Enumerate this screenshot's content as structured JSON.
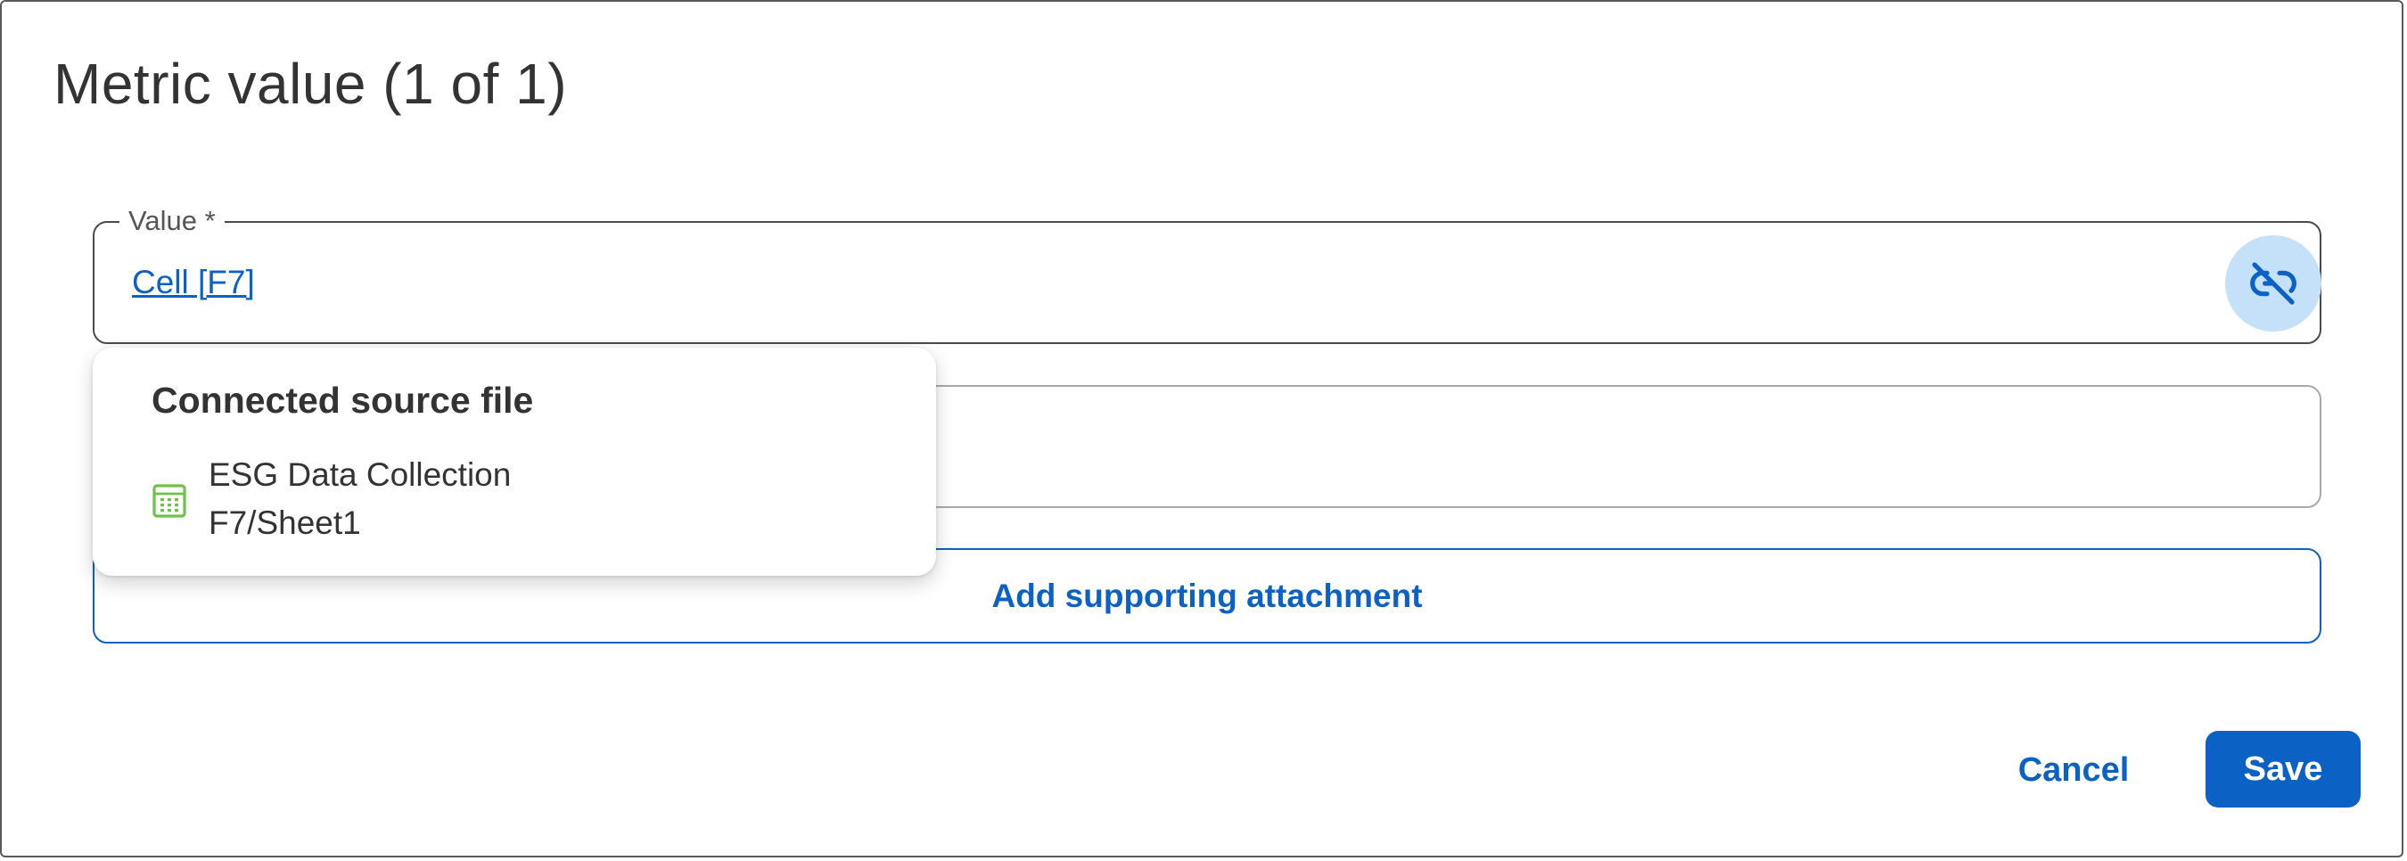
{
  "dialog": {
    "title": "Metric value (1 of 1)"
  },
  "value_field": {
    "label": "Value *",
    "value": "Cell [F7]",
    "unlink_icon": "link-off-icon"
  },
  "popover": {
    "title": "Connected source file",
    "file_icon": "spreadsheet-icon",
    "file_name": "ESG Data Collection",
    "file_path": "F7/Sheet1"
  },
  "attachment_button": {
    "label": "Add supporting attachment"
  },
  "actions": {
    "cancel_label": "Cancel",
    "save_label": "Save"
  },
  "colors": {
    "accent": "#0b62c4",
    "unlink_bg": "#c5e0f9",
    "spreadsheet_icon": "#6cc24a"
  }
}
